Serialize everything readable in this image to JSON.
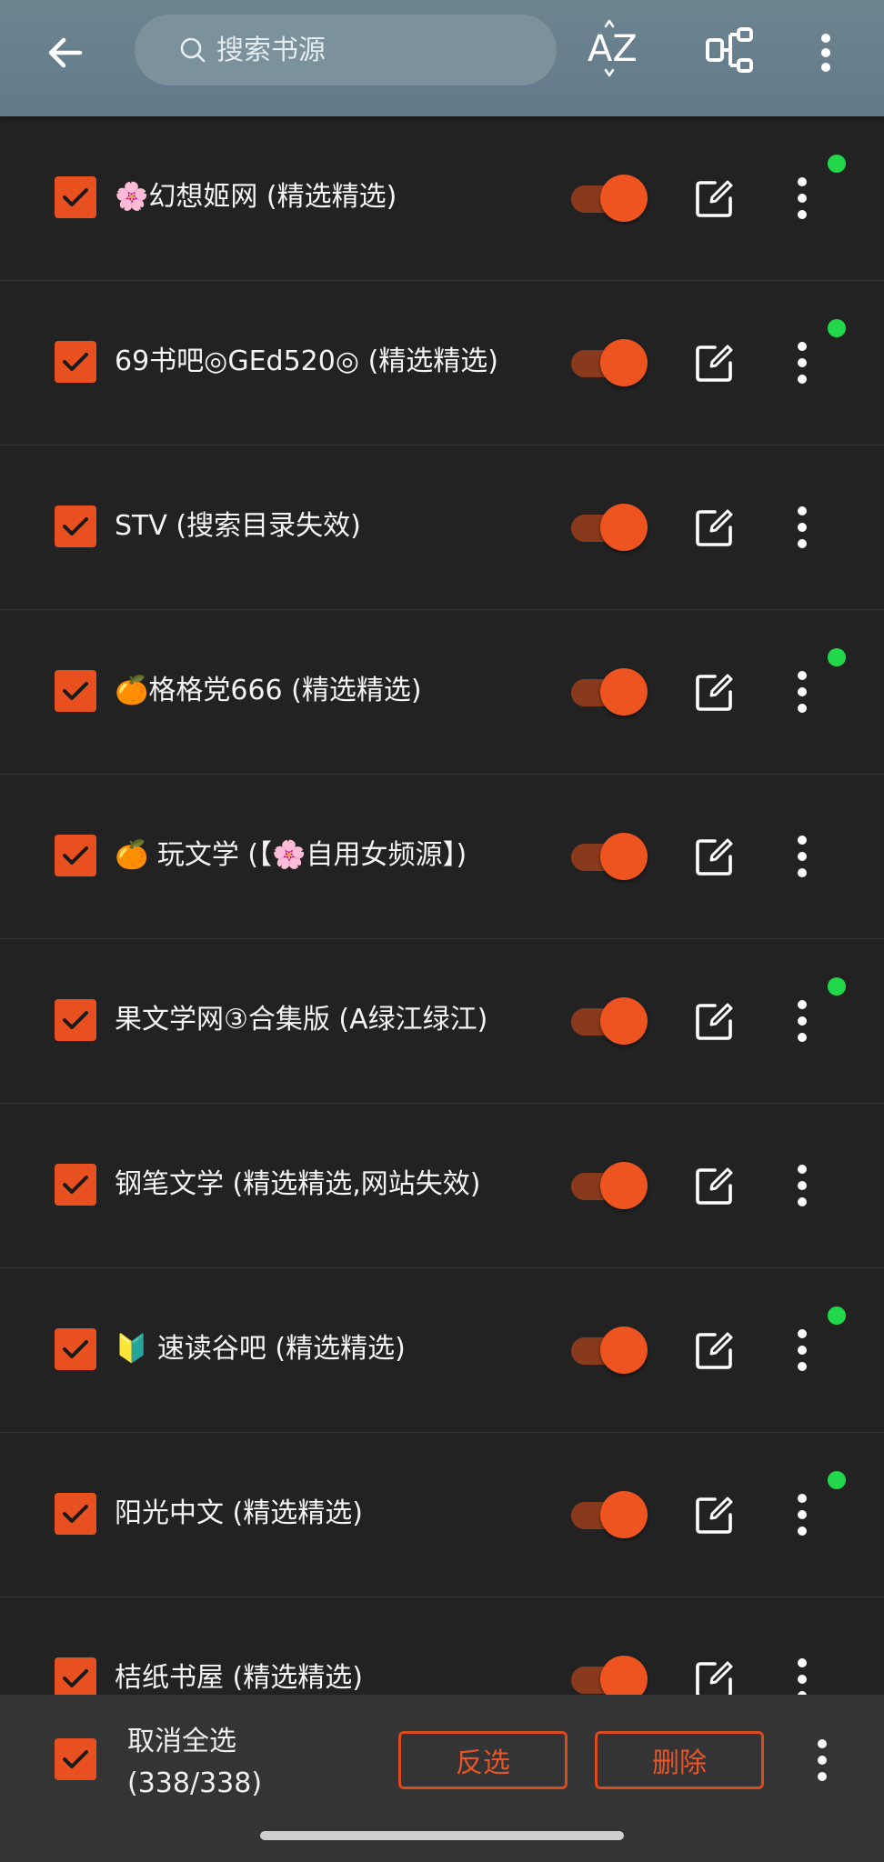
{
  "topbar": {
    "search_placeholder": "搜索书源",
    "sort_label": "AZ"
  },
  "sources": [
    {
      "prefix": "🌸",
      "name": "幻想姬网 (精选精选)",
      "checked": true,
      "enabled": true,
      "status_dot": true
    },
    {
      "prefix": "",
      "name": "69书吧◎GEd520◎ (精选精选)",
      "checked": true,
      "enabled": true,
      "status_dot": true
    },
    {
      "prefix": "",
      "name": "STV (搜索目录失效)",
      "checked": true,
      "enabled": true,
      "status_dot": false
    },
    {
      "prefix": "🍊",
      "name": "格格党666 (精选精选)",
      "checked": true,
      "enabled": true,
      "status_dot": true
    },
    {
      "prefix": "🍊",
      "name": " 玩文学 (【🌸自用女频源】)",
      "checked": true,
      "enabled": true,
      "status_dot": false
    },
    {
      "prefix": "",
      "name": "果文学网③合集版 (A绿江绿江)",
      "checked": true,
      "enabled": true,
      "status_dot": true
    },
    {
      "prefix": "",
      "name": "钢笔文学 (精选精选,网站失效)",
      "checked": true,
      "enabled": true,
      "status_dot": false
    },
    {
      "prefix": "🔰",
      "name": " 速读谷吧 (精选精选)",
      "checked": true,
      "enabled": true,
      "status_dot": true
    },
    {
      "prefix": "",
      "name": "阳光中文 (精选精选)",
      "checked": true,
      "enabled": true,
      "status_dot": true
    },
    {
      "prefix": "",
      "name": "桔纸书屋 (精选精选)",
      "checked": true,
      "enabled": true,
      "status_dot": false
    }
  ],
  "bottombar": {
    "select_label": "取消全选",
    "select_count": "(338/338)",
    "invert_label": "反选",
    "delete_label": "删除"
  },
  "colors": {
    "accent": "#e8501f",
    "toolbar": "#6d8591",
    "background": "#222222",
    "status_dot": "#22d84a"
  }
}
